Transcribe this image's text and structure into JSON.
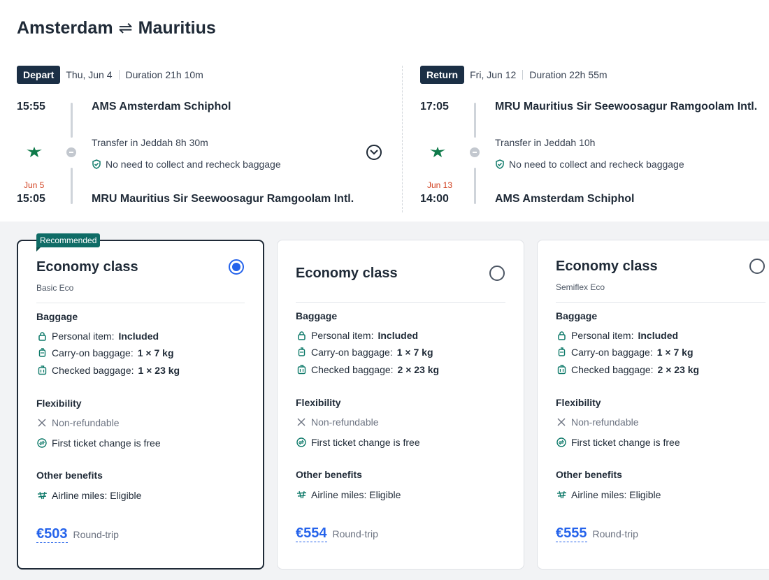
{
  "route": {
    "origin": "Amsterdam",
    "swap_symbol": "⇌",
    "destination": "Mauritius"
  },
  "depart": {
    "badge": "Depart",
    "date": "Thu, Jun 4",
    "duration": "Duration 21h 10m",
    "dep_time": "15:55",
    "dep_airport": "AMS Amsterdam Schiphol",
    "transfer": "Transfer in Jeddah  8h 30m",
    "baggage_note": "No need to collect and recheck baggage",
    "arr_nextday": "Jun 5",
    "arr_time": "15:05",
    "arr_airport": "MRU Mauritius Sir Seewoosagur Ramgoolam Intl."
  },
  "return": {
    "badge": "Return",
    "date": "Fri, Jun 12",
    "duration": "Duration 22h 55m",
    "dep_time": "17:05",
    "dep_airport": "MRU Mauritius Sir Seewoosagur Ramgoolam Intl.",
    "transfer": "Transfer in Jeddah  10h",
    "baggage_note": "No need to collect and recheck baggage",
    "arr_nextday": "Jun 13",
    "arr_time": "14:00",
    "arr_airport": "AMS Amsterdam Schiphol"
  },
  "colors": {
    "accent": "#2563eb",
    "badge_bg": "#1b2f45",
    "recommended_bg": "#0f6c66",
    "next_day": "#d1401f",
    "airline_green": "#0f7a4a"
  },
  "labels": {
    "baggage": "Baggage",
    "flexibility": "Flexibility",
    "other_benefits": "Other benefits",
    "personal_item": "Personal item: ",
    "carry_on": "Carry-on baggage: ",
    "checked": "Checked baggage: ",
    "non_refundable": "Non-refundable",
    "first_change": "First ticket change is free",
    "miles": "Airline miles: Eligible",
    "round_trip": "Round-trip",
    "recommended": "Recommended"
  },
  "fares": [
    {
      "name": "Economy class",
      "subtitle": "Basic Eco",
      "selected": true,
      "personal": "Included",
      "carry_on": "1 × 7 kg",
      "checked": "1 × 23 kg",
      "price": "€503"
    },
    {
      "name": "Economy class",
      "subtitle": "",
      "selected": false,
      "personal": "Included",
      "carry_on": "1 × 7 kg",
      "checked": "2 × 23 kg",
      "price": "€554"
    },
    {
      "name": "Economy class",
      "subtitle": "Semiflex Eco",
      "selected": false,
      "personal": "Included",
      "carry_on": "1 × 7 kg",
      "checked": "2 × 23 kg",
      "price": "€555"
    }
  ]
}
